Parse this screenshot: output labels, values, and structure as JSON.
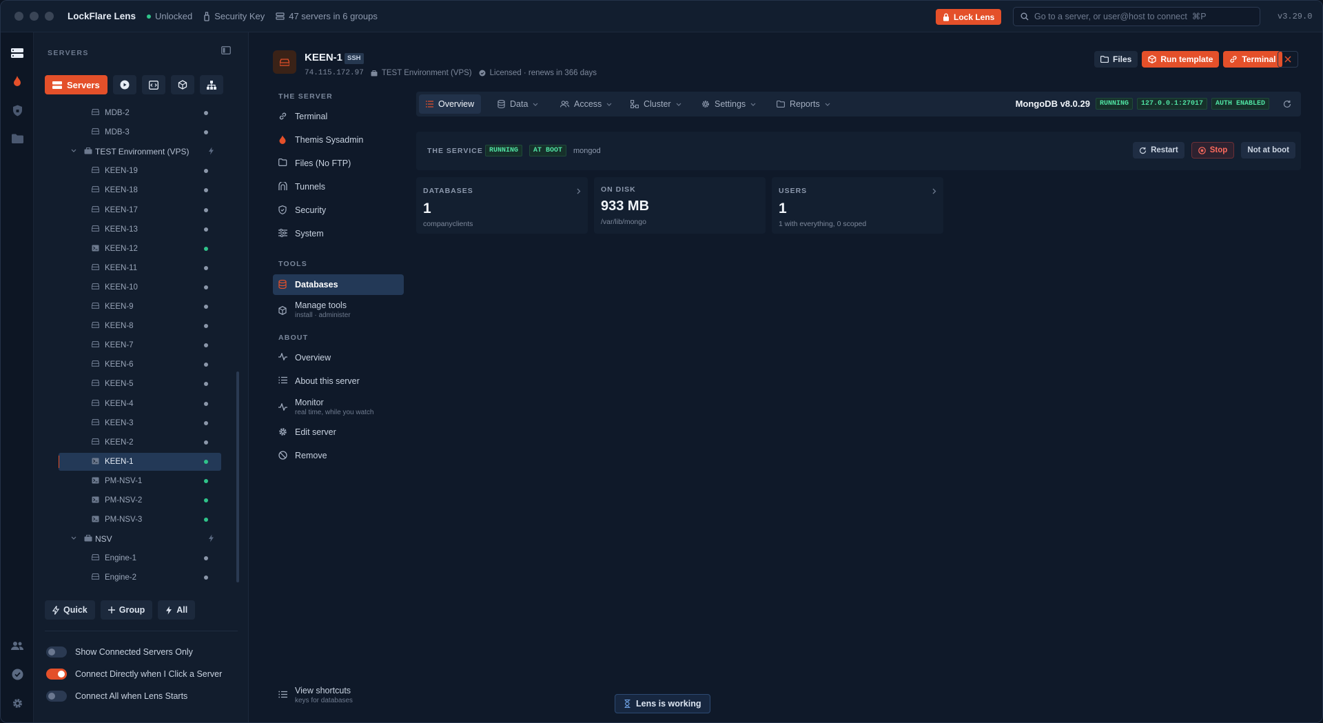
{
  "titlebar": {
    "app_title": "LockFlare Lens",
    "status": "Unlocked",
    "security_key": "Security Key",
    "servers_summary": "47 servers in 6 groups",
    "lock_button": "Lock Lens",
    "search_placeholder": "Go to a server, or user@host to connect  ⌘P",
    "version": "v3.29.0"
  },
  "sidebar": {
    "heading": "SERVERS",
    "servers_button": "Servers",
    "tree": [
      {
        "type": "server",
        "label": "MDB-2",
        "online": false
      },
      {
        "type": "server",
        "label": "MDB-3",
        "online": false
      },
      {
        "type": "group",
        "label": "TEST Environment (VPS)"
      },
      {
        "type": "server",
        "label": "KEEN-19",
        "online": false
      },
      {
        "type": "server",
        "label": "KEEN-18",
        "online": false
      },
      {
        "type": "server",
        "label": "KEEN-17",
        "online": false
      },
      {
        "type": "server",
        "label": "KEEN-13",
        "online": false
      },
      {
        "type": "server",
        "label": "KEEN-12",
        "online": true
      },
      {
        "type": "server",
        "label": "KEEN-11",
        "online": false
      },
      {
        "type": "server",
        "label": "KEEN-10",
        "online": false
      },
      {
        "type": "server",
        "label": "KEEN-9",
        "online": false
      },
      {
        "type": "server",
        "label": "KEEN-8",
        "online": false
      },
      {
        "type": "server",
        "label": "KEEN-7",
        "online": false
      },
      {
        "type": "server",
        "label": "KEEN-6",
        "online": false
      },
      {
        "type": "server",
        "label": "KEEN-5",
        "online": false
      },
      {
        "type": "server",
        "label": "KEEN-4",
        "online": false
      },
      {
        "type": "server",
        "label": "KEEN-3",
        "online": false
      },
      {
        "type": "server",
        "label": "KEEN-2",
        "online": false
      },
      {
        "type": "server",
        "label": "KEEN-1",
        "online": true,
        "selected": true
      },
      {
        "type": "server",
        "label": "PM-NSV-1",
        "online": true
      },
      {
        "type": "server",
        "label": "PM-NSV-2",
        "online": true
      },
      {
        "type": "server",
        "label": "PM-NSV-3",
        "online": true
      },
      {
        "type": "group",
        "label": "NSV"
      },
      {
        "type": "server",
        "label": "Engine-1",
        "online": false
      },
      {
        "type": "server",
        "label": "Engine-2",
        "online": false
      }
    ],
    "bottom_buttons": {
      "quick": "Quick",
      "group": "Group",
      "all": "All"
    },
    "toggles": [
      {
        "label": "Show Connected Servers Only",
        "on": false
      },
      {
        "label": "Connect Directly when I Click a Server",
        "on": true
      },
      {
        "label": "Connect All when Lens Starts",
        "on": false
      }
    ]
  },
  "server": {
    "name": "KEEN-1",
    "protocol": "SSH",
    "ip": "74.115.172.97",
    "group": "TEST Environment (VPS)",
    "license": "Licensed · renews in 366 days",
    "actions": {
      "files": "Files",
      "run_template": "Run template",
      "terminal": "Terminal"
    }
  },
  "nav": {
    "section_server": "THE SERVER",
    "server_items": [
      "Terminal",
      "Themis Sysadmin",
      "Files (No FTP)",
      "Tunnels",
      "Security",
      "System"
    ],
    "section_tools": "TOOLS",
    "databases": "Databases",
    "manage_tools": "Manage tools",
    "manage_tools_sub": "install · administer",
    "section_about": "ABOUT",
    "overview": "Overview",
    "about_server": "About this server",
    "monitor": "Monitor",
    "monitor_sub": "real time, while you watch",
    "edit_server": "Edit server",
    "remove": "Remove",
    "shortcuts": "View shortcuts",
    "shortcuts_sub": "keys for databases"
  },
  "tabs": {
    "items": [
      "Overview",
      "Data",
      "Access",
      "Cluster",
      "Settings",
      "Reports"
    ],
    "active": "Overview",
    "db_version": "MongoDB v8.0.29",
    "status": "RUNNING",
    "address": "127.0.0.1:27017",
    "auth": "AUTH ENABLED"
  },
  "service": {
    "title": "THE SERVICE",
    "status": "RUNNING",
    "boot": "AT BOOT",
    "process": "mongod",
    "restart": "Restart",
    "stop": "Stop",
    "not_at_boot": "Not at boot"
  },
  "cards": [
    {
      "title": "DATABASES",
      "value": "1",
      "sub": "companyclients"
    },
    {
      "title": "ON DISK",
      "value": "933 MB",
      "sub": "/var/lib/mongo"
    },
    {
      "title": "USERS",
      "value": "1",
      "sub": "1 with everything, 0 scoped"
    }
  ],
  "working": "Lens is working",
  "colors": {
    "accent": "#e4502a",
    "online": "#2fc48a",
    "badge_green": "#4fe0a1"
  }
}
